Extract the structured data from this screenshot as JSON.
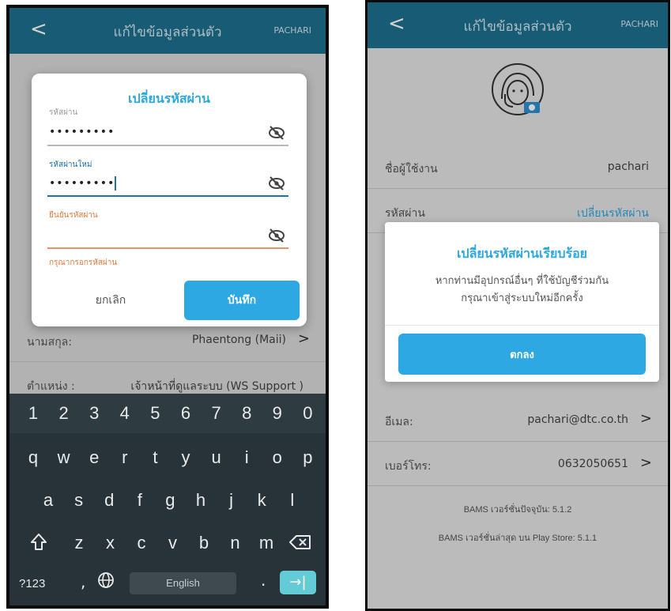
{
  "left": {
    "appbar": {
      "back": "<",
      "title": "แก้ไขข้อมูลส่วนตัว",
      "user": "PACHARI"
    },
    "background_rows": [
      {
        "label": "นามสกุล:",
        "value": "Phaentong (Maii)",
        "chevron": ">"
      },
      {
        "label": "ตำแหน่ง :",
        "value": "เจ้าหน้าที่ดูแลระบบ (WS Support )"
      }
    ],
    "dialog": {
      "title": "เปลี่ยนรหัสผ่าน",
      "current_label": "รหัสผ่าน",
      "current_value": "•••••••••",
      "new_label": "รหัสผ่านใหม่",
      "new_value": "•••••••••",
      "confirm_label": "ยืนยันรหัสผ่าน",
      "confirm_value": "",
      "error": "กรุณากรอกรหัสผ่าน",
      "cancel": "ยกเลิก",
      "save": "บันทึก"
    },
    "keyboard": {
      "numbers": [
        "1",
        "2",
        "3",
        "4",
        "5",
        "6",
        "7",
        "8",
        "9",
        "0"
      ],
      "row1": [
        "q",
        "w",
        "e",
        "r",
        "t",
        "y",
        "u",
        "i",
        "o",
        "p"
      ],
      "row2": [
        "a",
        "s",
        "d",
        "f",
        "g",
        "h",
        "j",
        "k",
        "l"
      ],
      "row3": [
        "z",
        "x",
        "c",
        "v",
        "b",
        "n",
        "m"
      ],
      "symbols_key": "?123",
      "comma": ",",
      "space_label": "English",
      "period": ".",
      "enter": "→|"
    }
  },
  "right": {
    "appbar": {
      "back": "<",
      "title": "แก้ไขข้อมูลส่วนตัว",
      "user": "PACHARI"
    },
    "rows": [
      {
        "label": "ชื่อผู้ใช้งาน",
        "value": "pachari"
      },
      {
        "label": "รหัสผ่าน",
        "value": "เปลี่ยนรหัสผ่าน"
      },
      {
        "label": "อีเมล:",
        "value": "pachari@dtc.co.th",
        "chevron": ">"
      },
      {
        "label": "เบอร์โทร:",
        "value": "0632050651",
        "chevron": ">"
      }
    ],
    "dialog": {
      "title": "เปลี่ยนรหัสผ่านเรียบร้อย",
      "line1": "หากท่านมีอุปกรณ์อื่นๆ ที่ใช้บัญชีร่วมกัน",
      "line2": "กรุณาเข้าสู่ระบบใหม่อีกครั้ง",
      "ok": "ตกลง"
    },
    "footer": {
      "current_version": "BAMS เวอร์ชั่นปัจจุบัน: 5.1.2",
      "latest_version": "BAMS เวอร์ชั่นล่าสุด บน Play Store: 5.1.1"
    }
  },
  "colors": {
    "appbar": "#1d6f8f",
    "accent": "#2da8e3",
    "error": "#e07a3a"
  }
}
